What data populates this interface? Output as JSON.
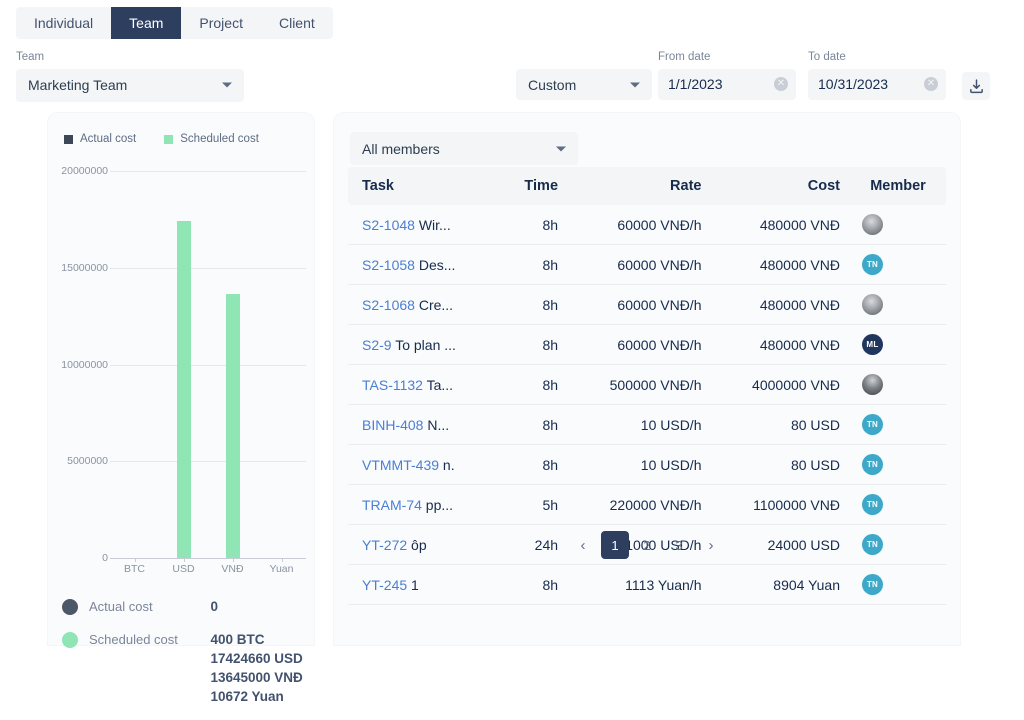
{
  "tabs": [
    {
      "label": "Individual",
      "active": false
    },
    {
      "label": "Team",
      "active": true
    },
    {
      "label": "Project",
      "active": false
    },
    {
      "label": "Client",
      "active": false
    }
  ],
  "filters": {
    "team_label": "Team",
    "team_value": "Marketing Team",
    "range_value": "Custom",
    "from_label": "From date",
    "from_value": "1/1/2023",
    "to_label": "To date",
    "to_value": "10/31/2023",
    "export_icon": "download-icon",
    "clear_glyph": "✕"
  },
  "chart_data": {
    "type": "bar",
    "title": "",
    "xlabel": "",
    "ylabel": "",
    "categories": [
      "BTC",
      "USD",
      "VNĐ",
      "Yuan"
    ],
    "ylim": [
      0,
      20000000
    ],
    "yticks": [
      "0",
      "5000000",
      "10000000",
      "15000000",
      "20000000"
    ],
    "grid": true,
    "legend_position": "top-left",
    "series": [
      {
        "name": "Actual cost",
        "color": "#3c4858",
        "values": [
          0,
          0,
          0,
          0
        ]
      },
      {
        "name": "Scheduled cost",
        "color": "#8fe5b4",
        "values": [
          400,
          17424660,
          13645000,
          10672
        ]
      }
    ],
    "summary": [
      {
        "name": "Actual cost",
        "color": "#4c5768",
        "values": [
          "0"
        ]
      },
      {
        "name": "Scheduled cost",
        "color": "#8fe5b4",
        "values": [
          "400 BTC",
          "17424660 USD",
          "13645000 VNĐ",
          "10672 Yuan"
        ]
      }
    ]
  },
  "table": {
    "member_filter": "All members",
    "columns": [
      "Task",
      "Time",
      "Rate",
      "Cost",
      "Member"
    ],
    "rows": [
      {
        "key": "S2-1048",
        "summary": "Wir...",
        "time": "8h",
        "rate": "60000 VNĐ/h",
        "cost": "480000 VNĐ",
        "avatar": {
          "type": "photo",
          "variant": "photo-a",
          "initials": ""
        }
      },
      {
        "key": "S2-1058",
        "summary": "Des...",
        "time": "8h",
        "rate": "60000 VNĐ/h",
        "cost": "480000 VNĐ",
        "avatar": {
          "type": "initials",
          "color": "#3ea8c9",
          "initials": "TN"
        }
      },
      {
        "key": "S2-1068",
        "summary": "Cre...",
        "time": "8h",
        "rate": "60000 VNĐ/h",
        "cost": "480000 VNĐ",
        "avatar": {
          "type": "photo",
          "variant": "photo-a",
          "initials": ""
        }
      },
      {
        "key": "S2-9",
        "summary": "To plan ...",
        "time": "8h",
        "rate": "60000 VNĐ/h",
        "cost": "480000 VNĐ",
        "avatar": {
          "type": "initials",
          "color": "#20365c",
          "initials": "ML"
        }
      },
      {
        "key": "TAS-1132",
        "summary": "Ta...",
        "time": "8h",
        "rate": "500000 VNĐ/h",
        "cost": "4000000 VNĐ",
        "avatar": {
          "type": "photo",
          "variant": "photo-b",
          "initials": ""
        }
      },
      {
        "key": "BINH-408",
        "summary": "N...",
        "time": "8h",
        "rate": "10 USD/h",
        "cost": "80 USD",
        "avatar": {
          "type": "initials",
          "color": "#3ea8c9",
          "initials": "TN"
        }
      },
      {
        "key": "VTMMT-439",
        "summary": "n.",
        "time": "8h",
        "rate": "10 USD/h",
        "cost": "80 USD",
        "avatar": {
          "type": "initials",
          "color": "#3ea8c9",
          "initials": "TN"
        }
      },
      {
        "key": "TRAM-74",
        "summary": "pp...",
        "time": "5h",
        "rate": "220000 VNĐ/h",
        "cost": "1100000 VNĐ",
        "avatar": {
          "type": "initials",
          "color": "#3ea8c9",
          "initials": "TN"
        }
      },
      {
        "key": "YT-272",
        "summary": "ôp",
        "time": "24h",
        "rate": "1000 USD/h",
        "cost": "24000 USD",
        "avatar": {
          "type": "initials",
          "color": "#3ea8c9",
          "initials": "TN"
        }
      },
      {
        "key": "YT-245",
        "summary": "1",
        "time": "8h",
        "rate": "1113 Yuan/h",
        "cost": "8904 Yuan",
        "avatar": {
          "type": "initials",
          "color": "#3ea8c9",
          "initials": "TN"
        }
      }
    ],
    "pagination": {
      "prev": "‹",
      "pages": [
        "1",
        "2",
        "3"
      ],
      "current": "1",
      "next": "›"
    }
  }
}
